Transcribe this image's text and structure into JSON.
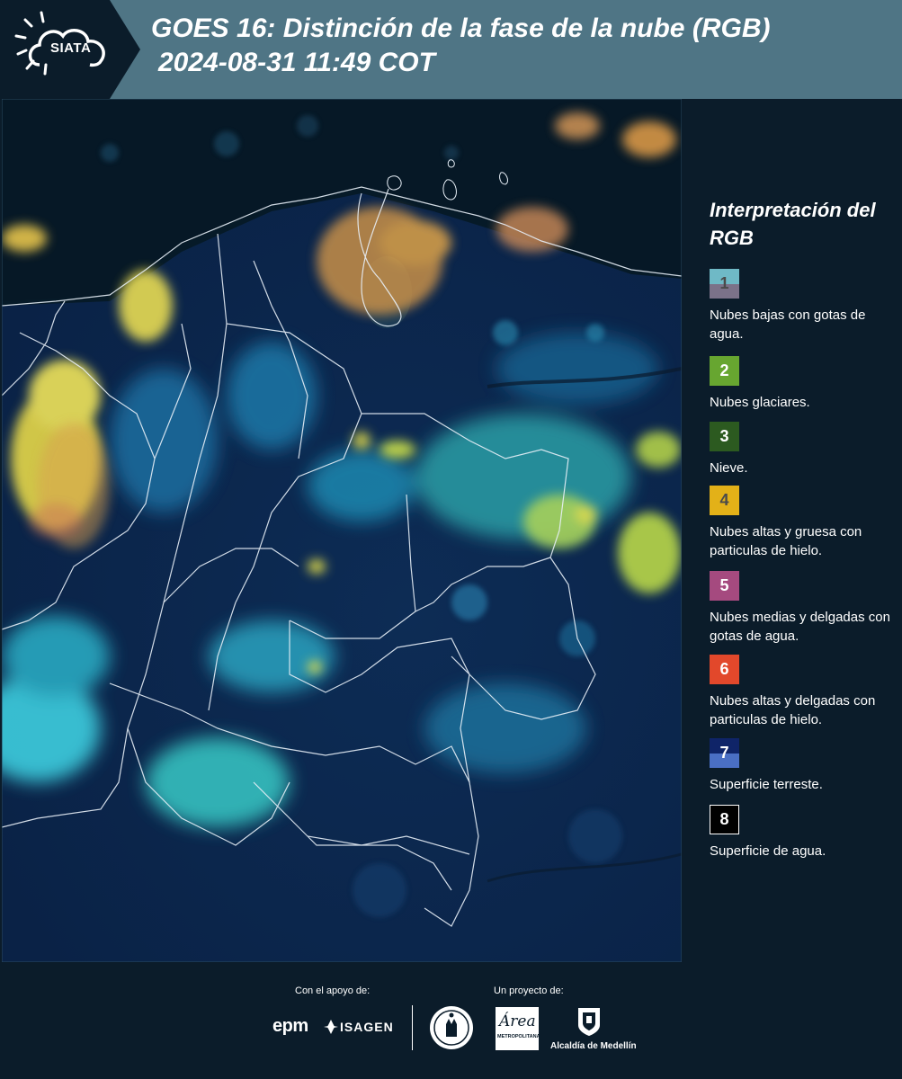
{
  "header": {
    "logo_text": "SIATA",
    "title": "GOES 16: Distinción de la fase de la nube (RGB)",
    "subtitle": "2024-08-31 11:49 COT"
  },
  "legend": {
    "title": "Interpretación del RGB",
    "items": [
      {
        "number": "1",
        "label": "Nubes bajas con gotas de agua.",
        "color_top": "#6fb9c6",
        "color_bottom": "#7b7289",
        "text_color": "#4a4a4a"
      },
      {
        "number": "2",
        "label": "Nubes glaciares.",
        "color_top": "#67a630",
        "color_bottom": "#67a630",
        "text_color": "#ffffff"
      },
      {
        "number": "3",
        "label": "Nieve.",
        "color_top": "#2c5a20",
        "color_bottom": "#2c5a20",
        "text_color": "#ffffff"
      },
      {
        "number": "4",
        "label": "Nubes altas y gruesa con particulas de hielo.",
        "color_top": "#e3b118",
        "color_bottom": "#e3b118",
        "text_color": "#4a4a4a"
      },
      {
        "number": "5",
        "label": "Nubes medias y delgadas con gotas de agua.",
        "color_top": "#a54a7f",
        "color_bottom": "#a54a7f",
        "text_color": "#ffffff"
      },
      {
        "number": "6",
        "label": "Nubes altas y delgadas con particulas de hielo.",
        "color_top": "#e2482b",
        "color_bottom": "#e2482b",
        "text_color": "#ffffff"
      },
      {
        "number": "7",
        "label": "Superficie terreste.",
        "color_top": "#0f2468",
        "color_bottom": "#4a6fc4",
        "text_color": "#ffffff"
      },
      {
        "number": "8",
        "label": "Superficie de agua.",
        "color_top": "#000000",
        "color_bottom": "#000000",
        "text_color": "#ffffff"
      }
    ]
  },
  "footer": {
    "support_label": "Con el apoyo de:",
    "project_label": "Un proyecto de:",
    "sponsors": [
      "epm",
      "ISAGEN"
    ],
    "partners": [
      "Área Metropolitana Valle de Aburrá",
      "Alcaldía de Medellín"
    ],
    "epm_text": "epm",
    "isagen_text": "ISAGEN",
    "area_text": "Área",
    "area_sub": "METROPOLITANA",
    "medellin_text": "Alcaldía de Medellín"
  },
  "map": {
    "product": "GOES 16 Cloud Phase Distinction RGB",
    "region": "Colombia"
  },
  "colors": {
    "header_bg": "#4f7585",
    "page_bg": "#0b1c2a",
    "ocean": "#061826",
    "land": "#0e2f5a"
  }
}
